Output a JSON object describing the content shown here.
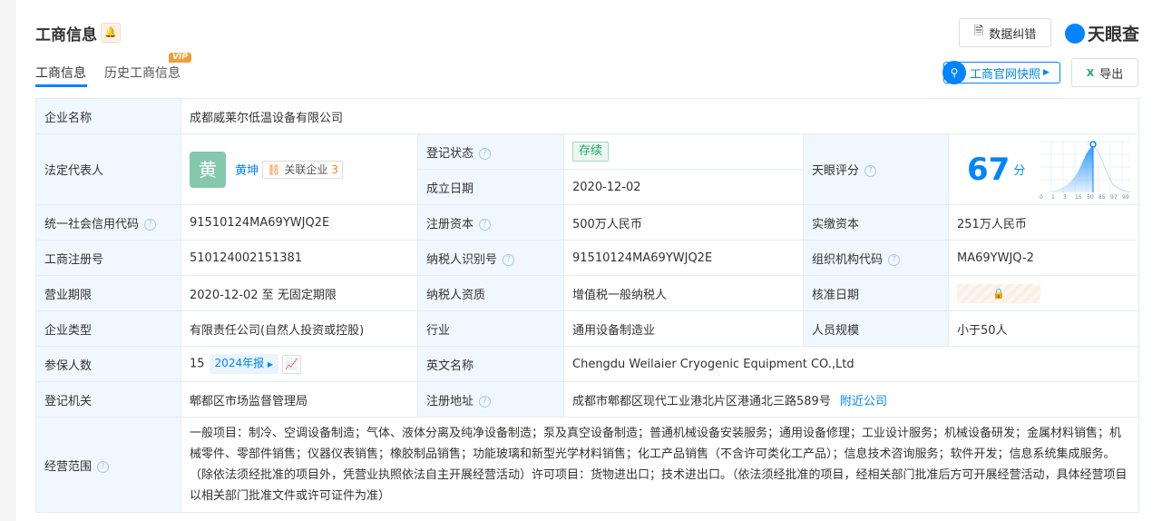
{
  "header": {
    "title": "工商信息",
    "bell_icon": "bell-icon",
    "correction_label": "数据纠错",
    "logo_text": "天眼查",
    "snapshot_label": "工商官网快照",
    "export_label": "导出"
  },
  "tabs": [
    {
      "label": "工商信息",
      "active": true
    },
    {
      "label": "历史工商信息",
      "badge": "VIP"
    }
  ],
  "rows": {
    "company_name": {
      "label": "企业名称",
      "value": "成都威莱尔低温设备有限公司"
    },
    "legal_rep": {
      "label": "法定代表人",
      "avatar": "黄",
      "name": "黄坤",
      "related_label": "关联企业",
      "related_count": "3"
    },
    "status": {
      "label": "登记状态",
      "value": "存续"
    },
    "founded": {
      "label": "成立日期",
      "value": "2020-12-02"
    },
    "score": {
      "label": "天眼评分",
      "value": "67",
      "unit": "分",
      "ticks": [
        "0",
        "1",
        "3",
        "15",
        "50",
        "85",
        "97",
        "99",
        "100"
      ]
    },
    "credit_code": {
      "label": "统一社会信用代码",
      "value": "91510124MA69YWJQ2E"
    },
    "reg_capital": {
      "label": "注册资本",
      "value": "500万人民币"
    },
    "paid_capital": {
      "label": "实缴资本",
      "value": "251万人民币"
    },
    "reg_no": {
      "label": "工商注册号",
      "value": "510124002151381"
    },
    "taxpayer_id": {
      "label": "纳税人识别号",
      "value": "91510124MA69YWJQ2E"
    },
    "org_code": {
      "label": "组织机构代码",
      "value": "MA69YWJQ-2"
    },
    "term": {
      "label": "营业期限",
      "value": "2020-12-02 至 无固定期限"
    },
    "taxpayer_type": {
      "label": "纳税人资质",
      "value": "增值税一般纳税人"
    },
    "approval_date": {
      "label": "核准日期",
      "locked_icon": "lock-icon"
    },
    "company_type": {
      "label": "企业类型",
      "value": "有限责任公司(自然人投资或控股)"
    },
    "industry": {
      "label": "行业",
      "value": "通用设备制造业"
    },
    "staff_size": {
      "label": "人员规模",
      "value": "小于50人"
    },
    "insured": {
      "label": "参保人数",
      "value": "15",
      "report": "2024年报"
    },
    "english_name": {
      "label": "英文名称",
      "value": "Chengdu Weilaier Cryogenic Equipment CO.,Ltd"
    },
    "authority": {
      "label": "登记机关",
      "value": "郫都区市场监督管理局"
    },
    "address": {
      "label": "注册地址",
      "value": "成都市郫都区现代工业港北片区港通北三路589号",
      "nearby": "附近公司"
    },
    "scope": {
      "label": "经营范围",
      "value": "一般项目：制冷、空调设备制造；气体、液体分离及纯净设备制造；泵及真空设备制造；普通机械设备安装服务；通用设备修理；工业设计服务；机械设备研发；金属材料销售；机械零件、零部件销售；仪器仪表销售；橡胶制品销售；功能玻璃和新型光学材料销售；化工产品销售（不含许可类化工产品）；信息技术咨询服务；软件开发；信息系统集成服务。（除依法须经批准的项目外，凭营业执照依法自主开展经营活动）许可项目：货物进出口；技术进出口。（依法须经批准的项目，经相关部门批准后方可开展经营活动，具体经营项目以相关部门批准文件或许可证件为准）"
    }
  },
  "colors": {
    "accent": "#0084ff",
    "label_bg": "#f0f7fe",
    "status_green": "#21a56a"
  }
}
